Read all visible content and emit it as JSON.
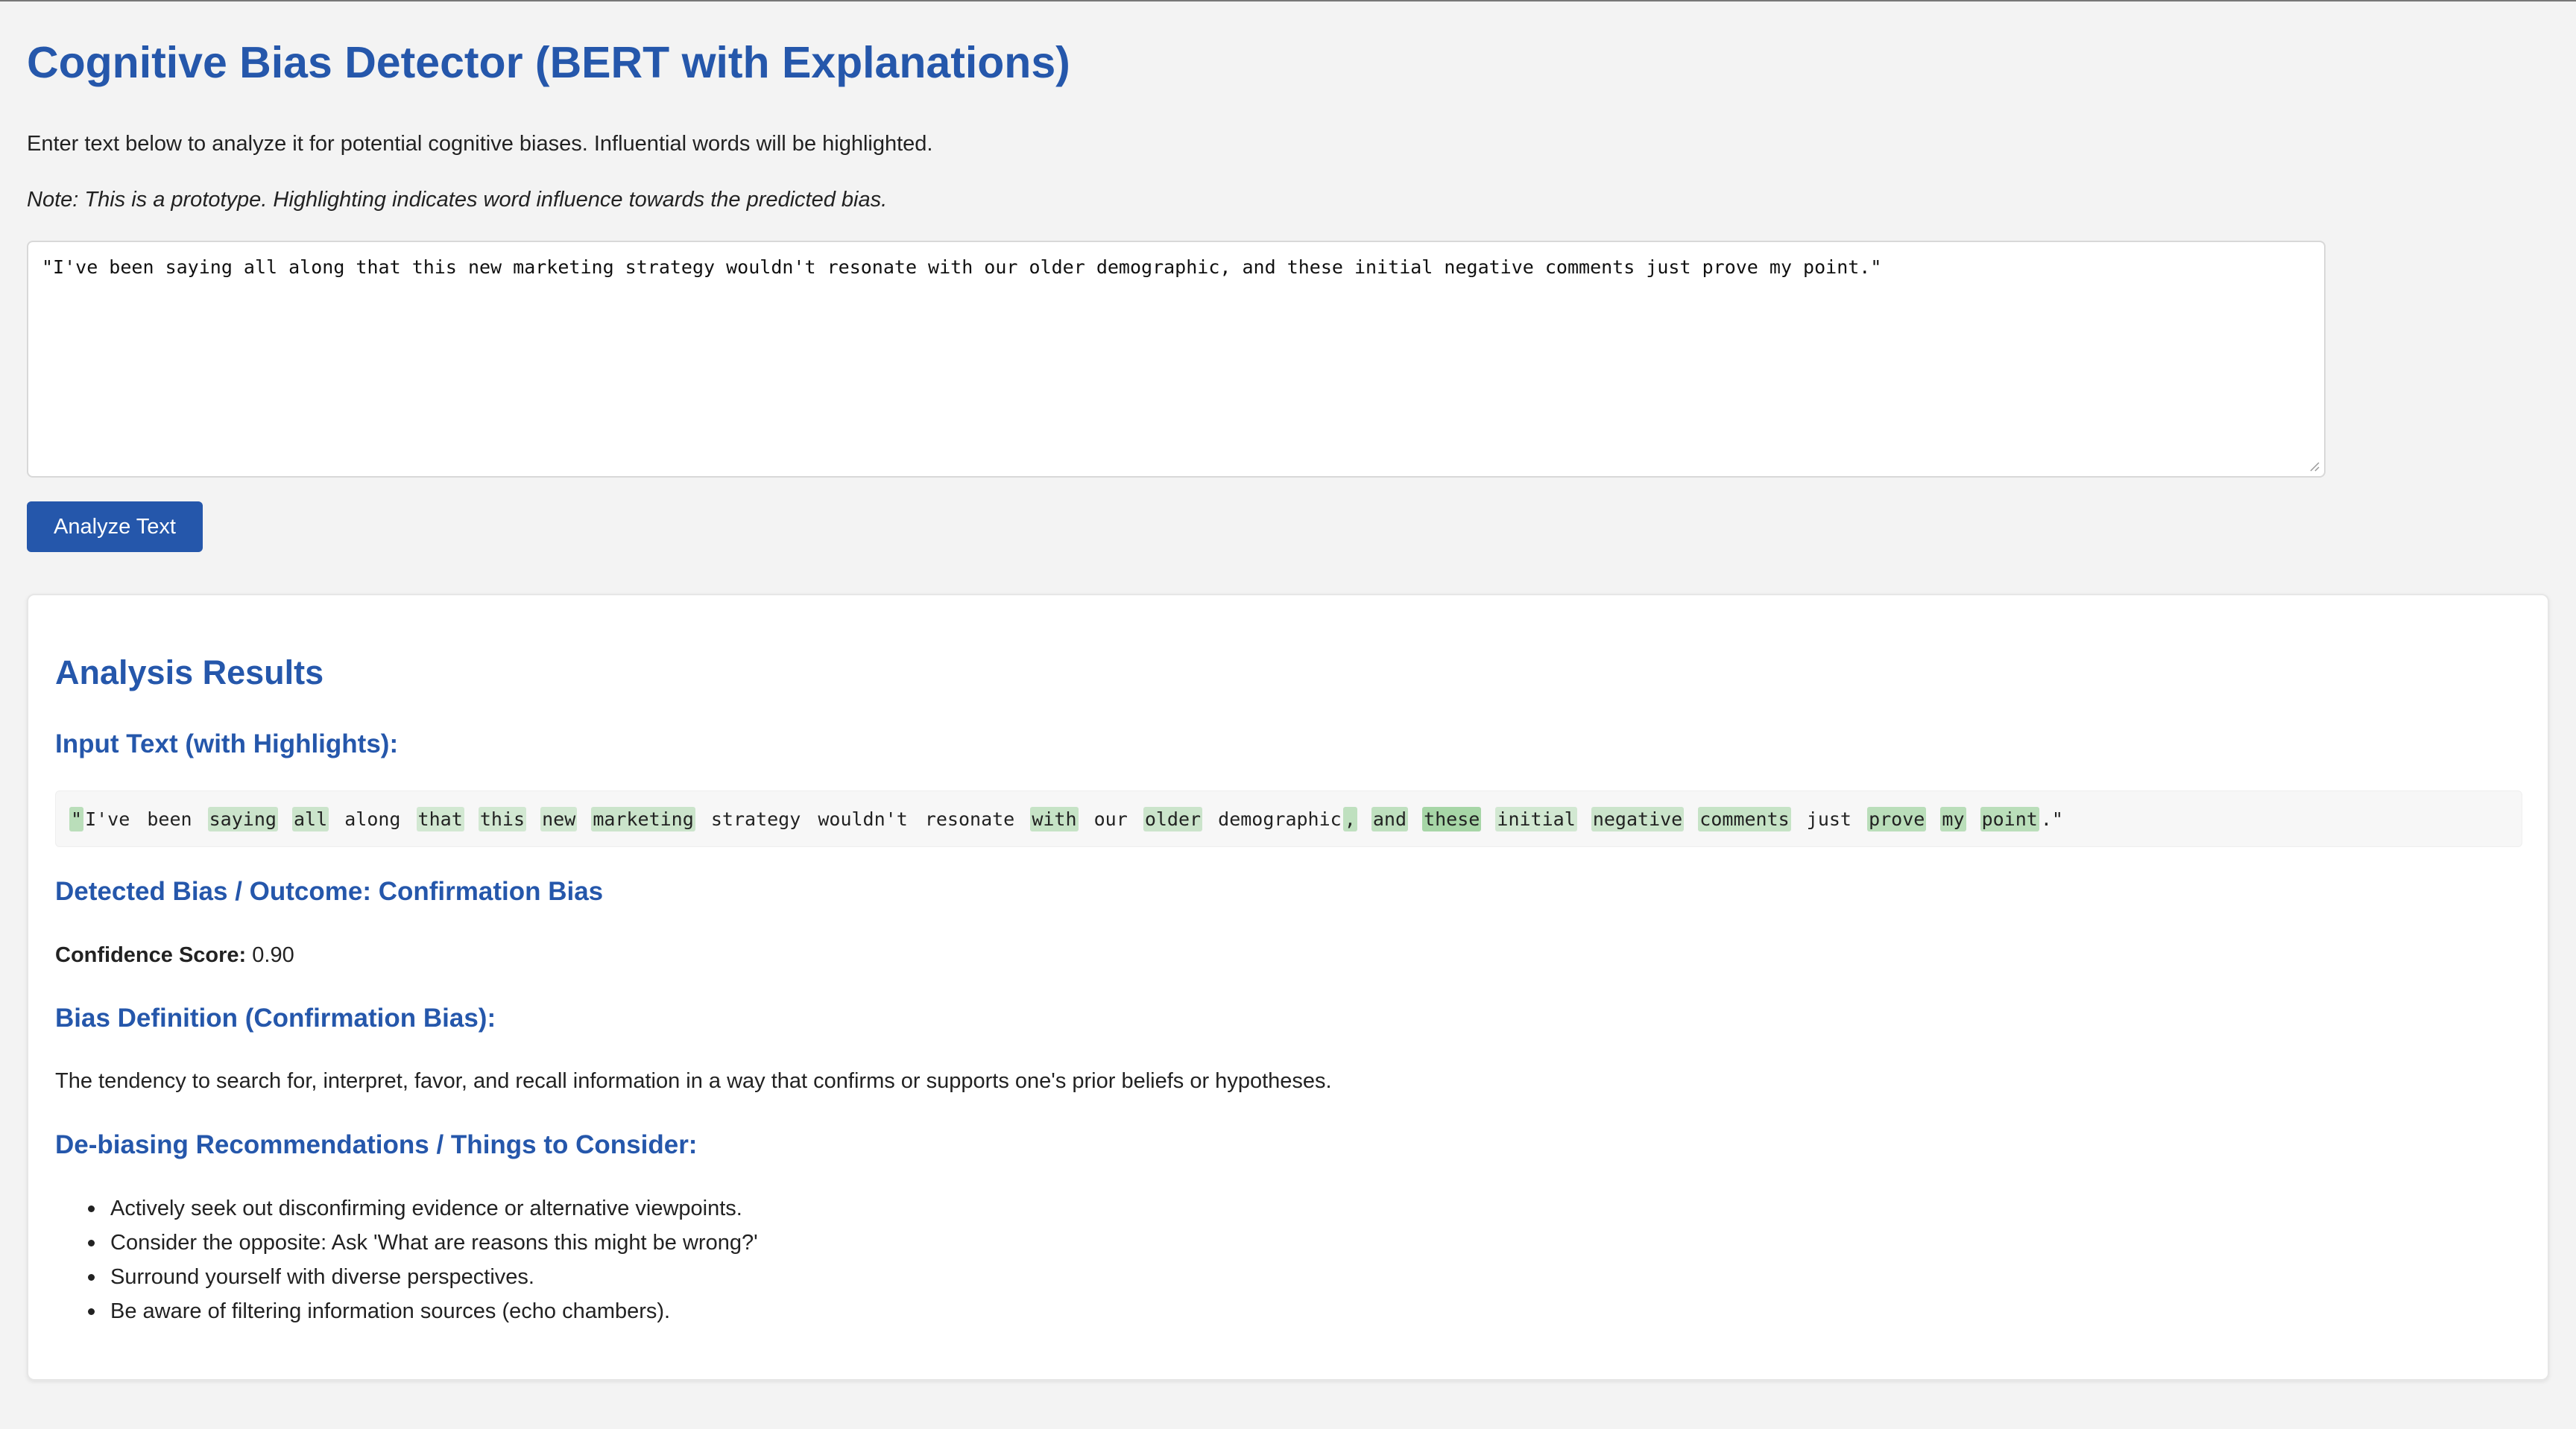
{
  "header": {
    "title": "Cognitive Bias Detector (BERT with Explanations)",
    "intro": "Enter text below to analyze it for potential cognitive biases. Influential words will be highlighted.",
    "note": "Note: This is a prototype. Highlighting indicates word influence towards the predicted bias."
  },
  "input": {
    "value": "\"I've been saying all along that this new marketing strategy wouldn't resonate with our older demographic, and these initial negative comments just prove my point.\""
  },
  "actions": {
    "analyze_label": "Analyze Text"
  },
  "results": {
    "heading": "Analysis Results",
    "highlight_heading": "Input Text (with Highlights):",
    "tokens": [
      {
        "text": "\"",
        "weight": 0.5
      },
      {
        "text": "I've",
        "weight": 0
      },
      {
        "text": " ",
        "weight": 0
      },
      {
        "text": "been",
        "weight": 0
      },
      {
        "text": " ",
        "weight": 0
      },
      {
        "text": "saying",
        "weight": 0.35
      },
      {
        "text": " ",
        "weight": 0
      },
      {
        "text": "all",
        "weight": 0.35
      },
      {
        "text": " ",
        "weight": 0
      },
      {
        "text": "along",
        "weight": 0
      },
      {
        "text": " ",
        "weight": 0
      },
      {
        "text": "that",
        "weight": 0.3
      },
      {
        "text": " ",
        "weight": 0
      },
      {
        "text": "this",
        "weight": 0.3
      },
      {
        "text": " ",
        "weight": 0
      },
      {
        "text": "new",
        "weight": 0.3
      },
      {
        "text": " ",
        "weight": 0
      },
      {
        "text": "marketing",
        "weight": 0.35
      },
      {
        "text": " ",
        "weight": 0
      },
      {
        "text": "strategy",
        "weight": 0
      },
      {
        "text": " ",
        "weight": 0
      },
      {
        "text": "wouldn't",
        "weight": 0
      },
      {
        "text": " ",
        "weight": 0
      },
      {
        "text": "resonate",
        "weight": 0
      },
      {
        "text": " ",
        "weight": 0
      },
      {
        "text": "with",
        "weight": 0.4
      },
      {
        "text": " ",
        "weight": 0
      },
      {
        "text": "our",
        "weight": 0
      },
      {
        "text": " ",
        "weight": 0
      },
      {
        "text": "older",
        "weight": 0.35
      },
      {
        "text": " ",
        "weight": 0
      },
      {
        "text": "demographic",
        "weight": 0
      },
      {
        "text": ",",
        "weight": 0.45
      },
      {
        "text": " ",
        "weight": 0
      },
      {
        "text": "and",
        "weight": 0.45
      },
      {
        "text": " ",
        "weight": 0
      },
      {
        "text": "these",
        "weight": 0.65
      },
      {
        "text": " ",
        "weight": 0
      },
      {
        "text": "initial",
        "weight": 0.3
      },
      {
        "text": " ",
        "weight": 0
      },
      {
        "text": "negative",
        "weight": 0.35
      },
      {
        "text": " ",
        "weight": 0
      },
      {
        "text": "comments",
        "weight": 0.4
      },
      {
        "text": " ",
        "weight": 0
      },
      {
        "text": "just",
        "weight": 0
      },
      {
        "text": " ",
        "weight": 0
      },
      {
        "text": "prove",
        "weight": 0.5
      },
      {
        "text": " ",
        "weight": 0
      },
      {
        "text": "my",
        "weight": 0.5
      },
      {
        "text": " ",
        "weight": 0
      },
      {
        "text": "point",
        "weight": 0.5
      },
      {
        "text": ".\"",
        "weight": 0
      }
    ],
    "detected_heading": "Detected Bias / Outcome: Confirmation Bias",
    "confidence_label": "Confidence Score:",
    "confidence_value": "0.90",
    "definition_heading": "Bias Definition (Confirmation Bias):",
    "definition_text": "The tendency to search for, interpret, favor, and recall information in a way that confirms or supports one's prior beliefs or hypotheses.",
    "recommendations_heading": "De-biasing Recommendations / Things to Consider:",
    "recommendations": [
      "Actively seek out disconfirming evidence or alternative viewpoints.",
      "Consider the opposite: Ask 'What are reasons this might be wrong?'",
      "Surround yourself with diverse perspectives.",
      "Be aware of filtering information sources (echo chambers)."
    ]
  },
  "colors": {
    "accent": "#2557ab",
    "highlight_base": "#6fbf6f",
    "background": "#f3f3f3"
  }
}
